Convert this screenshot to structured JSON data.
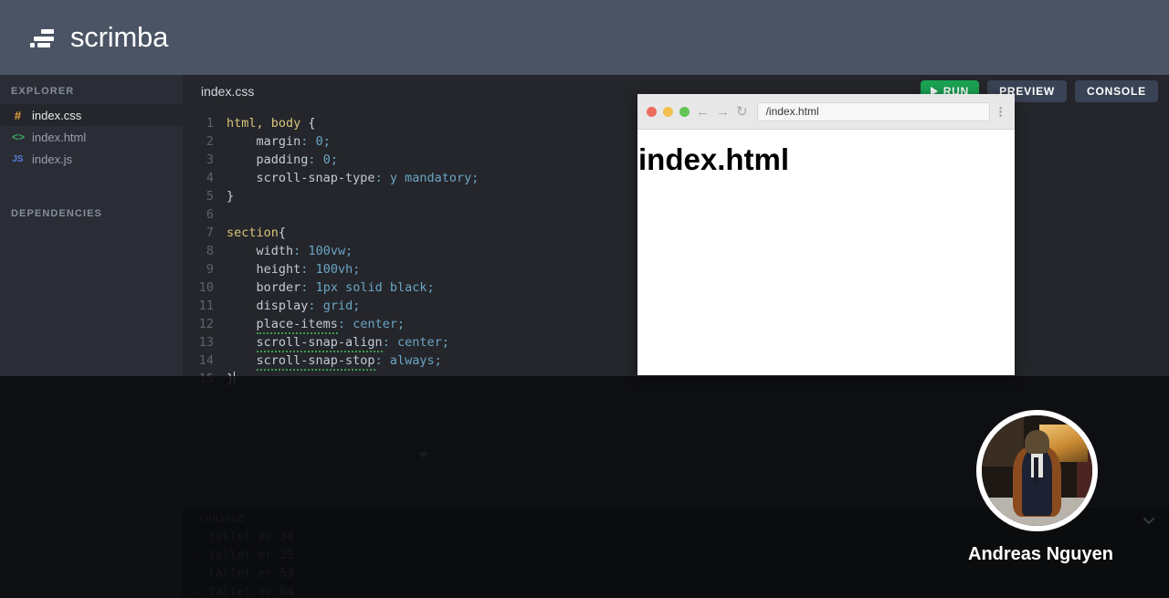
{
  "header": {
    "brand": "scrimba",
    "logo_icon": "scrimba-logo-icon"
  },
  "sidebar": {
    "explorer_label": "EXPLORER",
    "dependencies_label": "DEPENDENCIES",
    "files": [
      {
        "name": "index.css",
        "icon": "hash-icon",
        "icon_glyph": "#",
        "active": true
      },
      {
        "name": "index.html",
        "icon": "code-tags-icon",
        "icon_glyph": "<>",
        "active": false
      },
      {
        "name": "index.js",
        "icon": "js-icon",
        "icon_glyph": "JS",
        "active": false
      }
    ]
  },
  "editor": {
    "tab_label": "index.css",
    "lines": [
      {
        "n": "1",
        "t": "html, body {"
      },
      {
        "n": "2",
        "t": "    margin: 0;"
      },
      {
        "n": "3",
        "t": "    padding: 0;"
      },
      {
        "n": "4",
        "t": "    scroll-snap-type: y mandatory;"
      },
      {
        "n": "5",
        "t": "}"
      },
      {
        "n": "6",
        "t": ""
      },
      {
        "n": "7",
        "t": "section{"
      },
      {
        "n": "8",
        "t": "    width: 100vw;"
      },
      {
        "n": "9",
        "t": "    height: 100vh;"
      },
      {
        "n": "10",
        "t": "    border: 1px solid black;"
      },
      {
        "n": "11",
        "t": "    display: grid;"
      },
      {
        "n": "12",
        "t": "    place-items: center;"
      },
      {
        "n": "13",
        "t": "    scroll-snap-align: center;"
      },
      {
        "n": "14",
        "t": "    scroll-snap-stop: always;"
      },
      {
        "n": "15",
        "t": "}"
      }
    ]
  },
  "toolbar": {
    "run_label": "RUN",
    "run_icon": "play-icon",
    "preview_label": "PREVIEW",
    "console_label": "CONSOLE",
    "run_color": "#1aa353"
  },
  "browser": {
    "url": "/index.html",
    "back_icon": "arrow-left-icon",
    "forward_icon": "arrow-right-icon",
    "reload_icon": "reload-icon",
    "menu_icon": "kebab-menu-icon",
    "traffic_lights": [
      "#ed6a5e",
      "#f3bf4f",
      "#61c454"
    ],
    "page_heading": "index.html"
  },
  "console": {
    "title": "CONSOLE",
    "lines": [
      "tallet er 34",
      "tallet er 23",
      "tallet er 53",
      "tallet er 64"
    ]
  },
  "presenter": {
    "name": "Andreas Nguyen",
    "avatar_icon": "presenter-avatar",
    "collapse_icon": "chevron-down-icon"
  }
}
